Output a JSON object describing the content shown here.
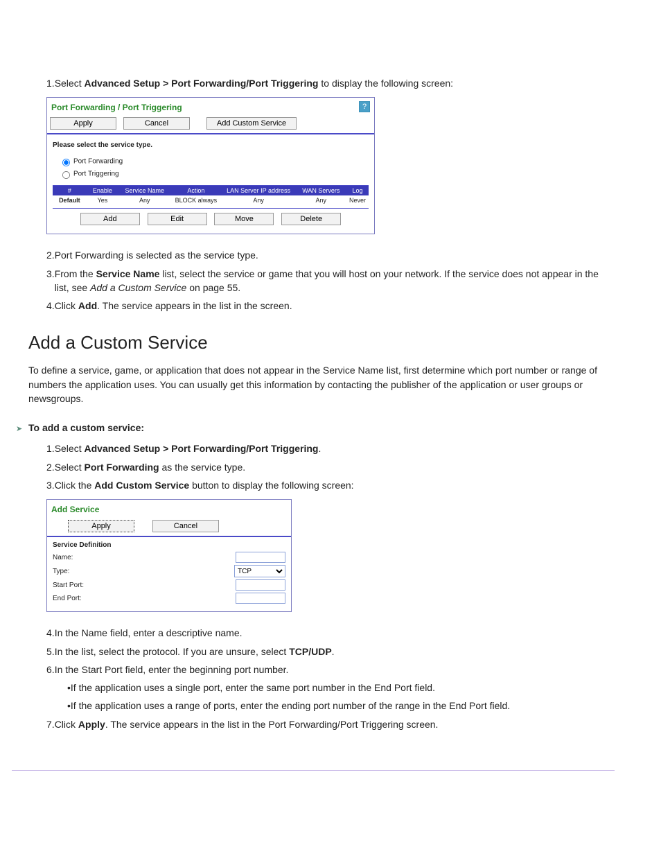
{
  "intro": {
    "instr1_prefix": "Select ",
    "instr1_bold": "Advanced Setup > Port Forwarding/Port Triggering",
    "instr1_suffix": " to display the following screen:"
  },
  "shot1": {
    "title": "Port Forwarding / Port Triggering",
    "help": "?",
    "btn_apply": "Apply",
    "btn_cancel": "Cancel",
    "btn_acs": "Add Custom Service",
    "subhead": "Please select the service type.",
    "radio_pf": "Port Forwarding",
    "radio_pt": "Port Triggering",
    "th": {
      "c1": "#",
      "c2": "Enable",
      "c3": "Service Name",
      "c4": "Action",
      "c5": "LAN Server IP address",
      "c6": "WAN Servers",
      "c7": "Log"
    },
    "row": {
      "c1": "Default",
      "c2": "Yes",
      "c3": "Any",
      "c4": "BLOCK always",
      "c5": "Any",
      "c6": "Any",
      "c7": "Never"
    },
    "btn_add": "Add",
    "btn_edit": "Edit",
    "btn_move": "Move",
    "btn_delete": "Delete"
  },
  "afterShot1": {
    "line2": "Port Forwarding is selected as the service type.",
    "line3a": "From the ",
    "line3bold": "Service Name",
    "line3b": " list, select the service or game that you will host on your network. If the service does not appear in the list, see ",
    "line3link": "Add a Custom Service",
    "line3c": " on page 55.",
    "line4a": "Click ",
    "line4bold": "Add",
    "line4b": ". The service appears in the list in the screen."
  },
  "customHeading": "Add a Custom Service",
  "customIntro": "To define a service, game, or application that does not appear in the Service Name list, first determine which port number or range of numbers the application uses. You can usually get this information by contacting the publisher of the application or user groups or newsgroups.",
  "arrowLabel": "To add a custom service:",
  "steps": {
    "s1a": "Select ",
    "s1bold": "Advanced Setup > Port Forwarding/Port Triggering",
    "s1b": ".",
    "s2a": "Select ",
    "s2bold": "Port Forwarding",
    "s2b": " as the service type.",
    "s3a": "Click the ",
    "s3bold": "Add Custom Service",
    "s3b": " button to display the following screen:"
  },
  "shot2": {
    "title": "Add Service",
    "btn_apply": "Apply",
    "btn_cancel": "Cancel",
    "sub": "Service Definition",
    "name_lbl": "Name:",
    "type_lbl": "Type:",
    "start_lbl": "Start Port:",
    "end_lbl": "End Port:",
    "type_val": "TCP"
  },
  "post": {
    "s4": "In the Name field, enter a descriptive name.",
    "s5a": "In the list, select the protocol. If you are unsure, select ",
    "s5bold": "TCP/UDP",
    "s5b": ".",
    "s6": "In the Start Port field, enter the beginning port number.",
    "s6bul1": "If the application uses a single port, enter the same port number in the End Port field.",
    "s6bul2": "If the application uses a range of ports, enter the ending port number of the range in the End Port field.",
    "s7a": "Click ",
    "s7bold": "Apply",
    "s7b": ". The service appears in the list in the Port Forwarding/Port Triggering screen."
  },
  "numbers": {
    "n1": "1.",
    "n2": "2.",
    "n3": "3.",
    "n4": "4.",
    "n5": "5.",
    "n6": "6.",
    "n7": "7.",
    "bull": "•"
  }
}
